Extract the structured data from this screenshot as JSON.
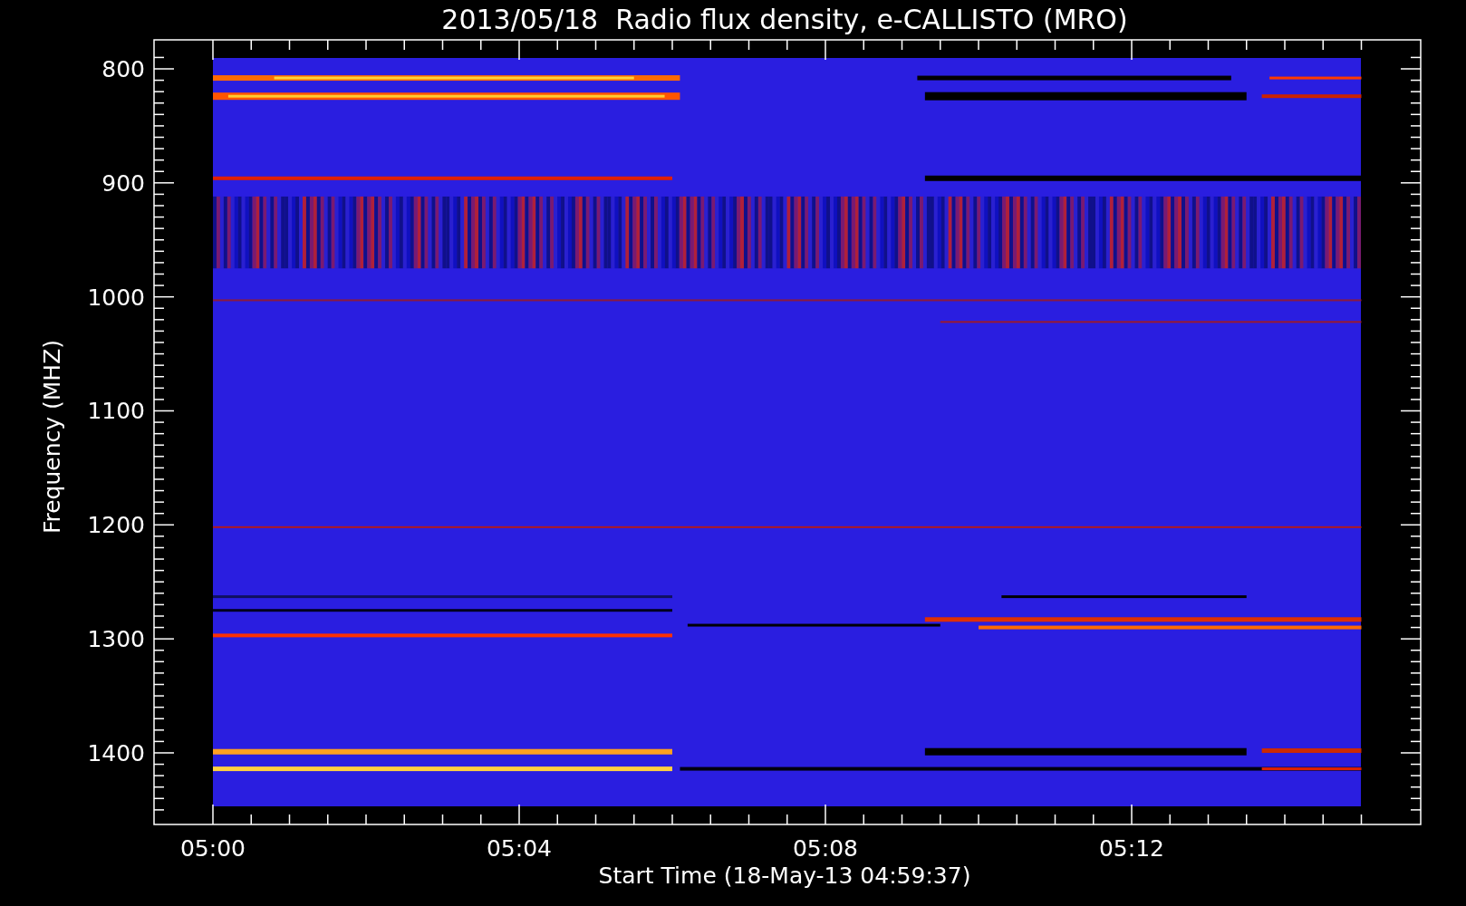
{
  "title": "2013/05/18  Radio flux density, e-CALLISTO (MRO)",
  "ylabel": "Frequency (MHZ)",
  "xlabel": "Start Time (18-May-13 04:59:37)",
  "yticks": [
    "800",
    "900",
    "1000",
    "1100",
    "1200",
    "1300",
    "1400"
  ],
  "xticks": [
    "05:00",
    "05:04",
    "05:08",
    "05:12"
  ]
}
